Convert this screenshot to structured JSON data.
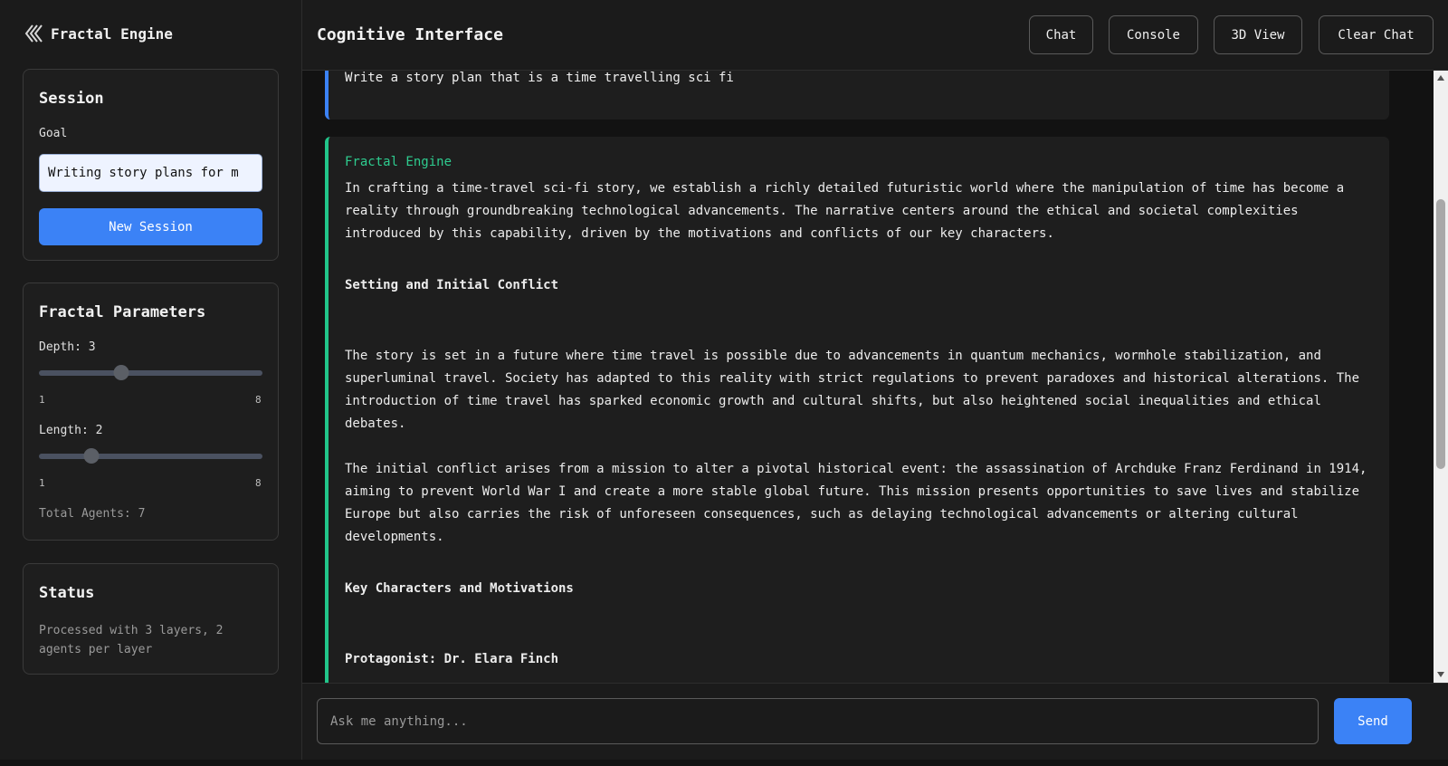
{
  "brand": {
    "name": "Fractal Engine",
    "icon": "double-chevron-left-icon"
  },
  "session": {
    "title": "Session",
    "goal_label": "Goal",
    "goal_value": "Writing story plans for m",
    "new_session_label": "New Session"
  },
  "params": {
    "title": "Fractal Parameters",
    "depth_label": "Depth: 3",
    "depth": {
      "value": 3,
      "min": 1,
      "max": 8,
      "min_label": "1",
      "max_label": "8"
    },
    "length_label": "Length: 2",
    "length": {
      "value": 2,
      "min": 1,
      "max": 8,
      "min_label": "1",
      "max_label": "8"
    },
    "total_agents": "Total Agents: 7"
  },
  "status": {
    "title": "Status",
    "line1": "Processed with 3 layers, 2",
    "line2": "agents per layer"
  },
  "header": {
    "title": "Cognitive Interface",
    "buttons": {
      "chat": "Chat",
      "console": "Console",
      "view3d": "3D View",
      "clear": "Clear Chat"
    }
  },
  "messages": {
    "user": "Write a story plan that is a time travelling sci fi",
    "ai_author": "Fractal Engine",
    "ai_p1": "In crafting a time-travel sci-fi story, we establish a richly detailed futuristic world where the manipulation of time has become a reality through groundbreaking technological advancements. The narrative centers around the ethical and societal complexities introduced by this capability, driven by the motivations and conflicts of our key characters.",
    "ai_h1": "Setting and Initial Conflict",
    "ai_p2": "The story is set in a future where time travel is possible due to advancements in quantum mechanics, wormhole stabilization, and superluminal travel. Society has adapted to this reality with strict regulations to prevent paradoxes and historical alterations. The introduction of time travel has sparked economic growth and cultural shifts, but also heightened social inequalities and ethical debates.",
    "ai_p3": "The initial conflict arises from a mission to alter a pivotal historical event: the assassination of Archduke Franz Ferdinand in 1914, aiming to prevent World War I and create a more stable global future. This mission presents opportunities to save lives and stabilize Europe but also carries the risk of unforeseen consequences, such as delaying technological advancements or altering cultural developments.",
    "ai_h2": "Key Characters and Motivations",
    "ai_h3": "Protagonist: Dr. Elara Finch"
  },
  "composer": {
    "placeholder": "Ask me anything...",
    "send_label": "Send"
  },
  "colors": {
    "accent": "#3b82f6",
    "ai_accent": "#22c58a",
    "ai_author": "#2ecc8f"
  }
}
